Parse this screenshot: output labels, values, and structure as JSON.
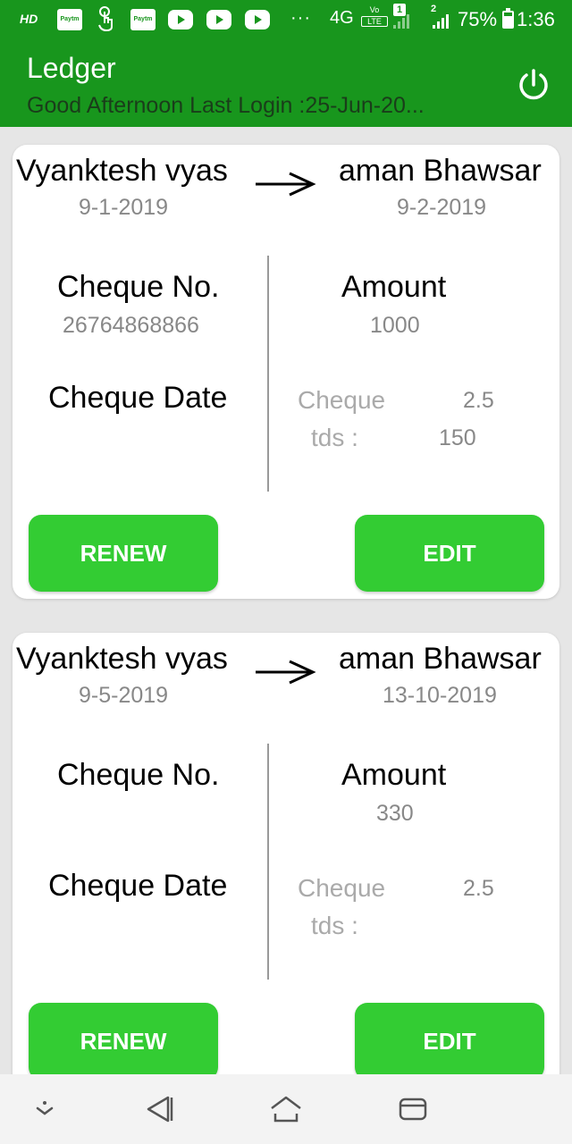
{
  "status_bar": {
    "hd": "HD",
    "app_labels": [
      "Paytm",
      "Paytm"
    ],
    "network": "4G",
    "volte": "Vo",
    "lte": "LTE",
    "sim1": "1",
    "sim2": "2",
    "battery": "75%",
    "time": "1:36",
    "icons": [
      "hd-icon",
      "paytm-icon",
      "touch-icon",
      "paytm-icon",
      "youtube-icon",
      "youtube-icon",
      "youtube-icon",
      "more-icon",
      "volte-icon",
      "signal-icon",
      "battery-icon"
    ]
  },
  "app_bar": {
    "title": "Ledger",
    "greeting": "Good Afternoon  Last Login :25-Jun-20...",
    "power_icon": "power-icon",
    "color": "#18961d"
  },
  "cards": [
    {
      "from_name": "Vyanktesh vyas",
      "from_date": "9-1-2019",
      "to_name": "aman Bhawsar",
      "to_date": "9-2-2019",
      "cheque_no_label": "Cheque No.",
      "cheque_no": "26764868866",
      "amount_label": "Amount",
      "amount": "1000",
      "cheque_date_label": "Cheque Date",
      "cheque_label": "Cheque",
      "cheque_value": "2.5",
      "tds_label": "tds  :",
      "tds_value": "150",
      "renew_label": "RENEW",
      "edit_label": "EDIT"
    },
    {
      "from_name": "Vyanktesh vyas",
      "from_date": "9-5-2019",
      "to_name": "aman Bhawsar",
      "to_date": "13-10-2019",
      "cheque_no_label": "Cheque No.",
      "cheque_no": "",
      "amount_label": "Amount",
      "amount": "330",
      "cheque_date_label": "Cheque Date",
      "cheque_label": "Cheque",
      "cheque_value": "2.5",
      "tds_label": "tds  :",
      "tds_value": "",
      "renew_label": "RENEW",
      "edit_label": "EDIT"
    }
  ],
  "nav_bar": {
    "icons": [
      "collapse-icon",
      "back-icon",
      "home-icon",
      "recents-icon"
    ]
  },
  "colors": {
    "accent": "#18961d",
    "button": "#33cc33",
    "background": "#e6e6e6"
  }
}
